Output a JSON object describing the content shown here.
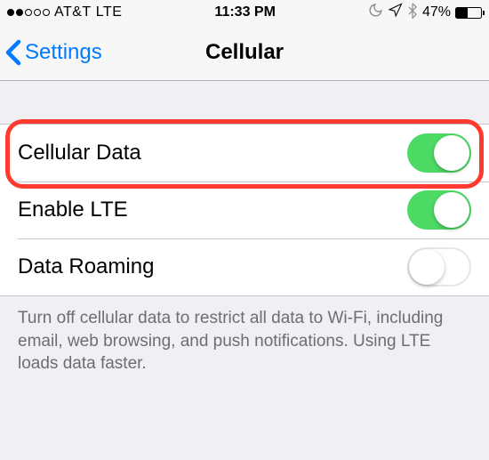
{
  "status": {
    "carrier": "AT&T",
    "network": "LTE",
    "time": "11:33 PM",
    "battery_pct": "47%",
    "battery_fill": "47%"
  },
  "nav": {
    "back_label": "Settings",
    "title": "Cellular"
  },
  "rows": {
    "cellular_data": {
      "label": "Cellular Data",
      "on": true
    },
    "enable_lte": {
      "label": "Enable LTE",
      "on": true
    },
    "data_roaming": {
      "label": "Data Roaming",
      "on": false
    }
  },
  "footer": "Turn off cellular data to restrict all data to Wi-Fi, including email, web browsing, and push notifications. Using LTE loads data faster."
}
